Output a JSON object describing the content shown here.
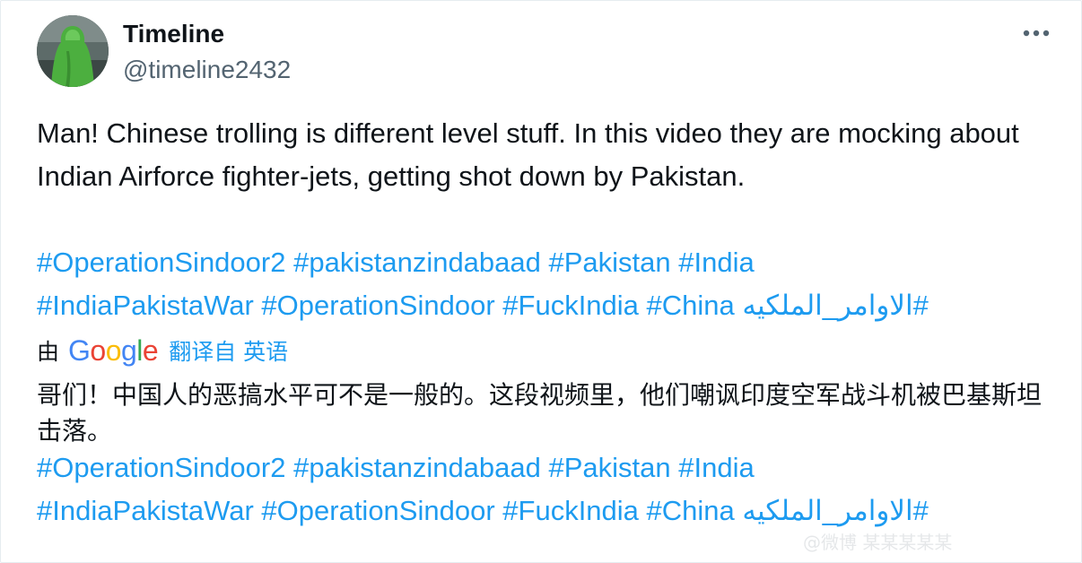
{
  "author": {
    "name": "Timeline",
    "handle": "@timeline2432"
  },
  "tweet": {
    "text": "Man! Chinese trolling is different level stuff. In this video they are mocking about Indian Airforce fighter-jets, getting shot down by Pakistan.",
    "hashtags_line1": [
      "#OperationSindoor2",
      "#pakistanzindabaad",
      "#Pakistan",
      "#India"
    ],
    "hashtags_line2": [
      "#IndiaPakistaWar",
      "#OperationSindoor",
      "#FuckIndia",
      "#China",
      "#الاوامر_الملكيه"
    ]
  },
  "translation": {
    "by_label": "由",
    "provider": "Google",
    "from_label": "翻译自 英语",
    "text": "哥们！中国人的恶搞水平可不是一般的。这段视频里，他们嘲讽印度空军战斗机被巴基斯坦击落。",
    "hashtags_line1": [
      "#OperationSindoor2",
      "#pakistanzindabaad",
      "#Pakistan",
      "#India"
    ],
    "hashtags_line2": [
      "#IndiaPakistaWar",
      "#OperationSindoor",
      "#FuckIndia",
      "#China",
      "#الاوامر_الملكيه"
    ]
  },
  "icons": {
    "more": "more-horizontal-icon",
    "avatar": "avatar-green-raincoat"
  },
  "colors": {
    "link": "#1d9bf0",
    "text": "#0f1419",
    "secondary": "#536471"
  },
  "watermark": {
    "text": "@微博 某某某某某"
  }
}
